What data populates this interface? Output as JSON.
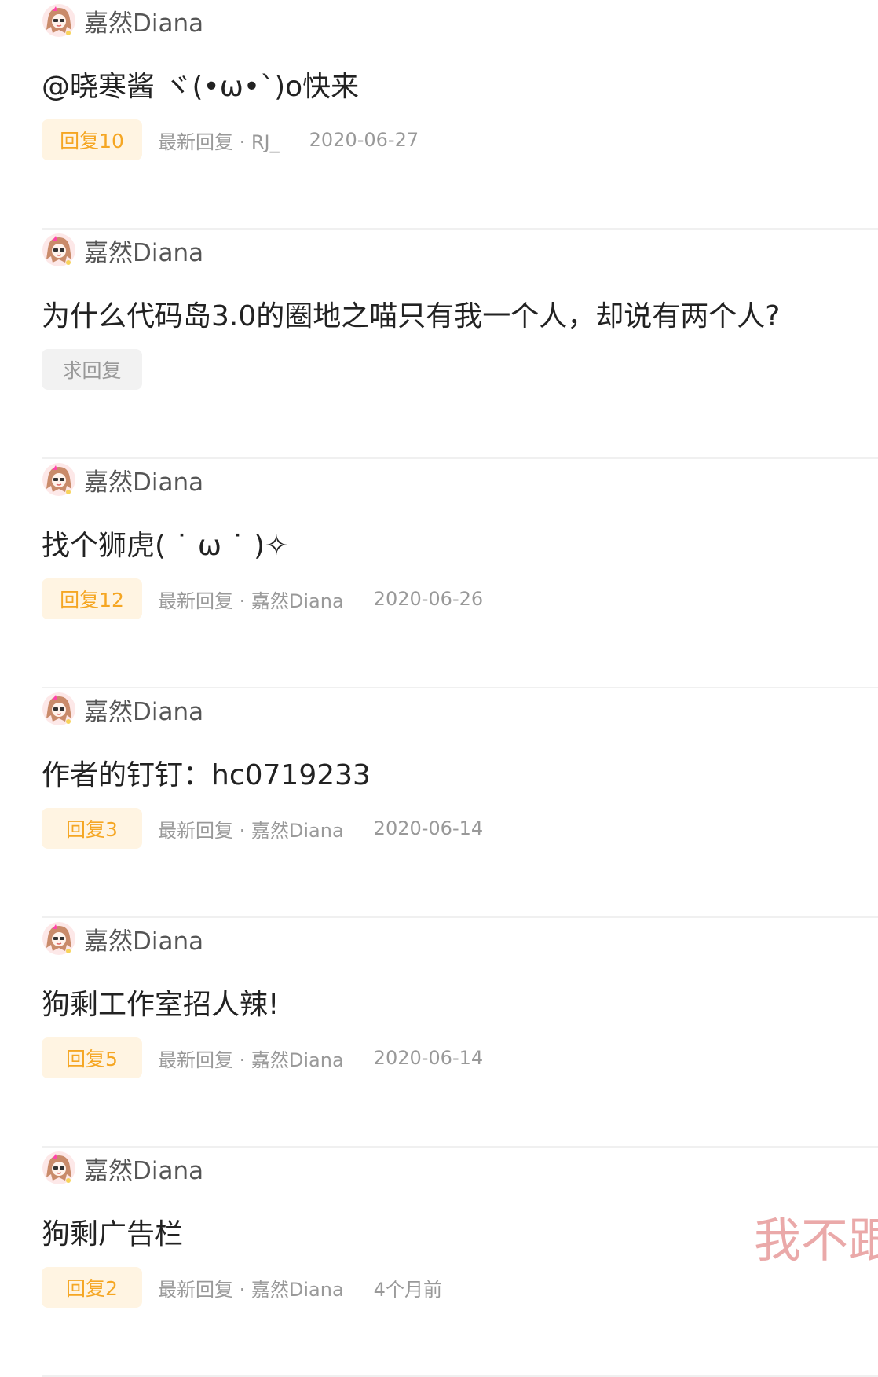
{
  "posts": [
    {
      "author": "嘉然Diana",
      "title": "@晓寒酱 ヾ(•ω•`)o快来",
      "reply_label": "回复10",
      "latest_reply": "最新回复 · RJ_",
      "date": "2020-06-27"
    },
    {
      "author": "嘉然Diana",
      "title": "为什么代码岛3.0的圈地之喵只有我一个人，却说有两个人?",
      "reply_label": "求回复",
      "latest_reply": "",
      "date": ""
    },
    {
      "author": "嘉然Diana",
      "title": "找个狮虎( ˙ ω ˙ )✧",
      "reply_label": "回复12",
      "latest_reply": "最新回复 · 嘉然Diana",
      "date": "2020-06-26"
    },
    {
      "author": "嘉然Diana",
      "title": "作者的钉钉：hc0719233",
      "reply_label": "回复3",
      "latest_reply": "最新回复 · 嘉然Diana",
      "date": "2020-06-14"
    },
    {
      "author": "嘉然Diana",
      "title": "狗剩工作室招人辣!",
      "reply_label": "回复5",
      "latest_reply": "最新回复 · 嘉然Diana",
      "date": "2020-06-14"
    },
    {
      "author": "嘉然Diana",
      "title": "狗剩广告栏",
      "reply_label": "回复2",
      "latest_reply": "最新回复 · 嘉然Diana",
      "date": "4个月前"
    }
  ],
  "watermark_text": "我不跟",
  "colors": {
    "reply_badge_bg": "#fff4e2",
    "reply_badge_text": "#f5a623",
    "muted_text": "#999999",
    "divider": "#f0f0f0",
    "watermark": "#e8a0a0"
  },
  "icons": {
    "avatar": "girl-avatar-icon"
  }
}
